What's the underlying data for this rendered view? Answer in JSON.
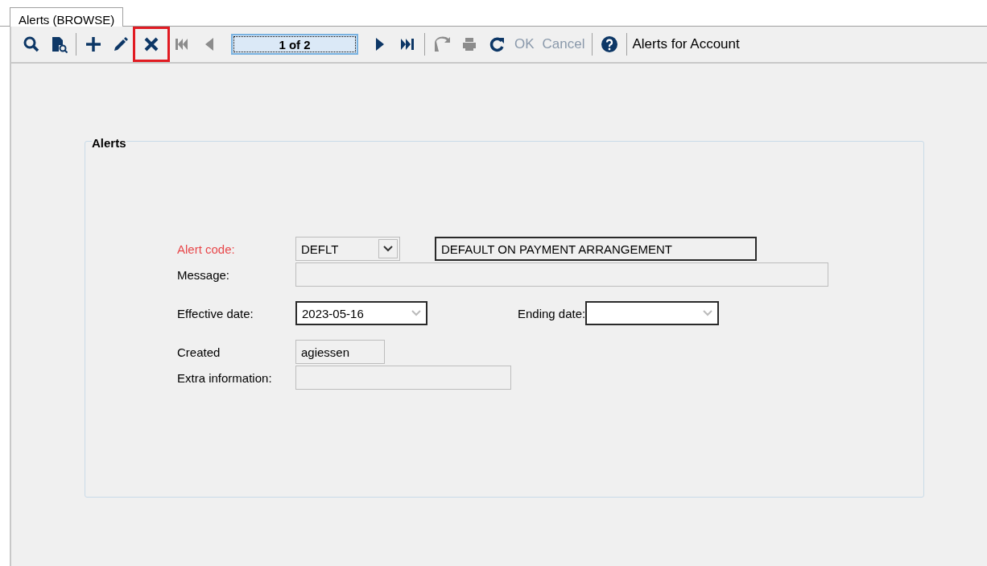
{
  "tabs": [
    {
      "label": "Alerts (BROWSE)",
      "selected": true
    }
  ],
  "toolbar": {
    "items": [
      {
        "kind": "icon",
        "disabled": false,
        "highlighted": false
      },
      {
        "kind": "icon",
        "disabled": false,
        "highlighted": false
      },
      {
        "kind": "separator"
      },
      {
        "kind": "icon",
        "disabled": false,
        "highlighted": false
      },
      {
        "kind": "icon",
        "disabled": false,
        "highlighted": false
      },
      {
        "kind": "icon",
        "disabled": false,
        "highlighted": true
      },
      {
        "kind": "icon",
        "disabled": true,
        "highlighted": false
      },
      {
        "kind": "icon",
        "disabled": true,
        "highlighted": false
      },
      {
        "kind": "record",
        "label": "1 of 2"
      },
      {
        "kind": "icon",
        "disabled": false,
        "highlighted": false
      },
      {
        "kind": "icon",
        "disabled": false,
        "highlighted": false
      },
      {
        "kind": "separator"
      },
      {
        "kind": "icon",
        "disabled": true,
        "highlighted": false
      },
      {
        "kind": "icon",
        "disabled": true,
        "highlighted": false
      },
      {
        "kind": "icon",
        "disabled": false,
        "highlighted": false
      },
      {
        "kind": "text",
        "label": "OK",
        "disabled": true,
        "highlighted": false
      },
      {
        "kind": "text",
        "label": "Cancel",
        "disabled": true,
        "highlighted": false
      },
      {
        "kind": "separator"
      },
      {
        "kind": "icon",
        "disabled": false,
        "highlighted": false
      },
      {
        "kind": "separator"
      },
      {
        "kind": "title",
        "label": "Alerts for Account"
      }
    ]
  },
  "group": {
    "title": "Alerts",
    "alert_code": {
      "label": "Alert code:",
      "required": true,
      "value": "DEFLT",
      "description": "DEFAULT ON PAYMENT ARRANGEMENT"
    },
    "message": {
      "label": "Message:",
      "required": false
    },
    "effective_date": {
      "label": "Effective date:",
      "required": false,
      "value": "2023-05-16"
    },
    "ending_date": {
      "label": "Ending date:",
      "required": false
    },
    "created": {
      "label": "Created",
      "required": false,
      "value": "agiessen"
    },
    "extra_information": {
      "label": "Extra information:",
      "required": false
    }
  }
}
